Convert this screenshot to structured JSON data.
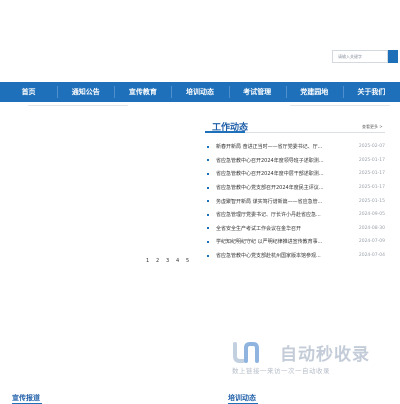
{
  "search": {
    "placeholder": "请输入关键字"
  },
  "nav": {
    "items": [
      "首页",
      "通知公告",
      "宣传教育",
      "培训动态",
      "考试管理",
      "党建园地",
      "关于我们"
    ]
  },
  "work_news": {
    "title": "工作动态",
    "more": "查看更多 >",
    "items": [
      {
        "title": "新春开新局 奋进正当时——省厅党委书记、厅...",
        "date": "2025-02-07"
      },
      {
        "title": "省应急管教中心召开2024年度领导班子述职测...",
        "date": "2025-01-17"
      },
      {
        "title": "省应急管教中心召开2024年度中层干部述职测...",
        "date": "2025-01-17"
      },
      {
        "title": "省应急管教中心党支部召开2024年度民主评议...",
        "date": "2025-01-17"
      },
      {
        "title": "务虚聚智开新局 谋实笃行谱新篇——省应急管...",
        "date": "2025-01-15"
      },
      {
        "title": "省应急管理厅党委书记、厅长许小丹赴省应急...",
        "date": "2024-09-05"
      },
      {
        "title": "全省安全生产考试工作会议在金华召开",
        "date": "2024-08-30"
      },
      {
        "title": "学纪知纪明纪守纪 以严明纪律推进宣传教育事...",
        "date": "2024-07-09"
      },
      {
        "title": "省应急管教中心党支部赴杭州国家版本馆参观...",
        "date": "2024-07-04"
      }
    ]
  },
  "pager": [
    "1",
    "2",
    "3",
    "4",
    "5"
  ],
  "watermark": {
    "title": "自动秒收录",
    "subtitle": "数上链接一来访一次一自动收录"
  },
  "bottom": {
    "left_title": "宣传报道",
    "right_title": "培训动态"
  },
  "colors": {
    "primary": "#1e70ba",
    "accent_text": "#1e5ea8"
  }
}
